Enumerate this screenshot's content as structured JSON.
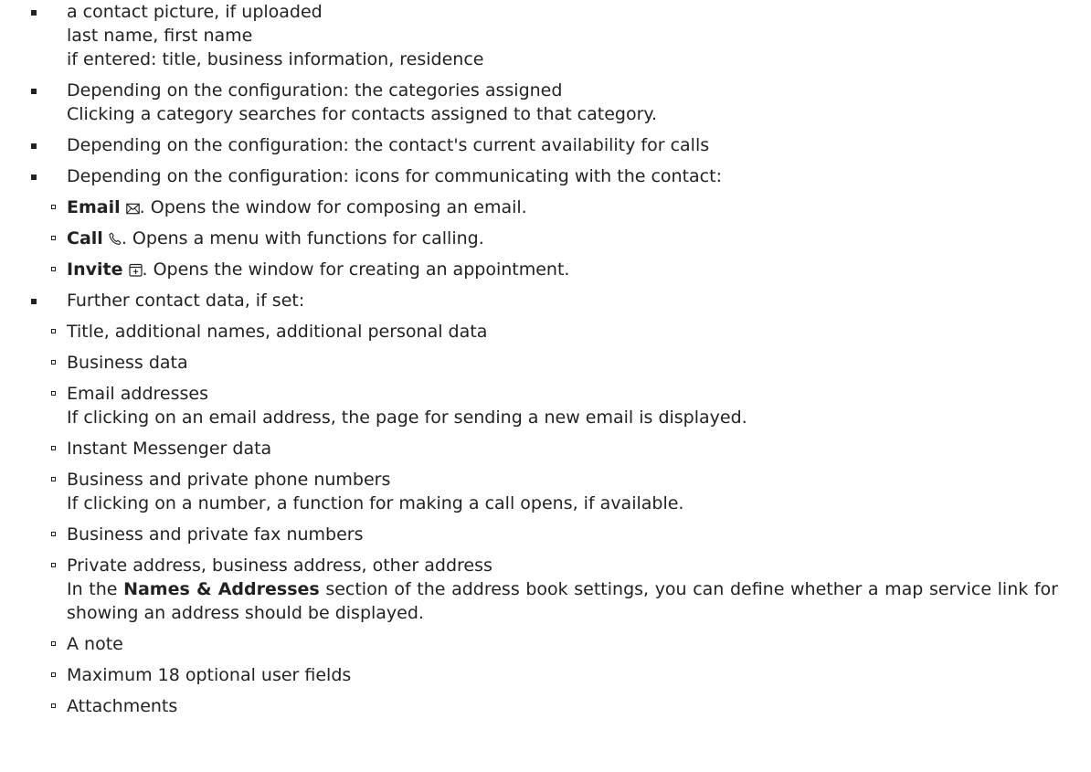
{
  "items": [
    {
      "lines": [
        "a contact picture, if uploaded",
        "last name, first name",
        "if entered: title, business information, residence"
      ]
    },
    {
      "lines": [
        "Depending on the configuration: the categories assigned",
        "Clicking a category searches for contacts assigned to that category."
      ]
    },
    {
      "lines": [
        "Depending on the configuration: the contact's current availability for calls"
      ]
    },
    {
      "lines": [
        "Depending on the configuration: icons for communicating with the contact:"
      ],
      "sub": [
        {
          "bold": "Email",
          "icon": "envelope-icon",
          "rest": ". Opens the window for composing an email."
        },
        {
          "bold": "Call",
          "icon": "phone-icon",
          "rest": ". Opens a menu with functions for calling."
        },
        {
          "bold": "Invite",
          "icon": "calendar-plus-icon",
          "rest": ". Opens the window for creating an appointment."
        }
      ]
    },
    {
      "lines": [
        "Further contact data, if set:"
      ],
      "sub": [
        {
          "lines": [
            "Title, additional names, additional personal data"
          ]
        },
        {
          "lines": [
            "Business data"
          ]
        },
        {
          "lines": [
            "Email addresses",
            "If clicking on an email address, the page for sending a new email is displayed."
          ]
        },
        {
          "lines": [
            "Instant Messenger data"
          ]
        },
        {
          "lines": [
            "Business and private phone numbers",
            "If clicking on a number, a function for making a call opens, if available."
          ]
        },
        {
          "lines": [
            "Business and private fax numbers"
          ]
        },
        {
          "lines": [
            "Private address, business address, other address"
          ],
          "para": {
            "before": "In the ",
            "bold": "Names & Addresses",
            "after": " section of the address book settings, you can define whether a map service link for showing an address should be displayed."
          }
        },
        {
          "lines": [
            "A note"
          ]
        },
        {
          "lines": [
            "Maximum 18 optional user fields"
          ]
        },
        {
          "lines": [
            "Attachments"
          ]
        }
      ]
    }
  ]
}
